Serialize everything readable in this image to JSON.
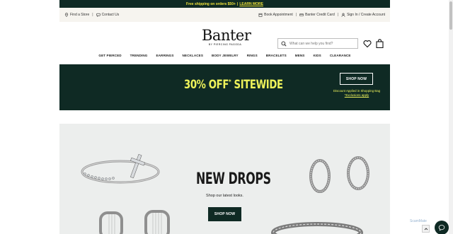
{
  "promo": {
    "text": "Free shipping on orders $50+",
    "separator": "|",
    "link": "LEARN MORE"
  },
  "utility": {
    "find_store": "Find a Store",
    "contact": "Contact Us",
    "book": "Book Appointment",
    "credit": "Banter Credit Card",
    "signin": "Sign In / Create Account",
    "separator": "|"
  },
  "header": {
    "logo_word": "Banter",
    "logo_sub": "BY PIERCING PAGODA",
    "search_placeholder": "What can we help you find?"
  },
  "nav": {
    "items": [
      "GET PIERCED",
      "TRENDING",
      "EARRINGS",
      "NECKLACES",
      "BODY JEWELRY",
      "RINGS",
      "BRACELETS",
      "MENS",
      "KIDS",
      "CLEARANCE"
    ]
  },
  "sale": {
    "headline": "30% OFF",
    "asterisk": "*",
    "headline_tail": " SITEWIDE",
    "button": "SHOP NOW",
    "note": "Discount Applied in Shopping Bag",
    "exclusions": "*Exclusions apply"
  },
  "hero": {
    "title": "NEW DROPS",
    "subtitle": "Shop our latest looks.",
    "button": "SHOP NOW"
  },
  "widgets": {
    "watermark": "ScamMate"
  },
  "colors": {
    "brand_dark": "#0f2a24",
    "accent_yellow": "#eef25a",
    "hero_bg": "#eceeed"
  },
  "icons": [
    "location-pin-icon",
    "chat-bubble-icon",
    "calendar-icon",
    "credit-card-icon",
    "user-icon",
    "search-icon",
    "heart-icon",
    "shopping-bag-icon",
    "chevron-up-icon"
  ]
}
